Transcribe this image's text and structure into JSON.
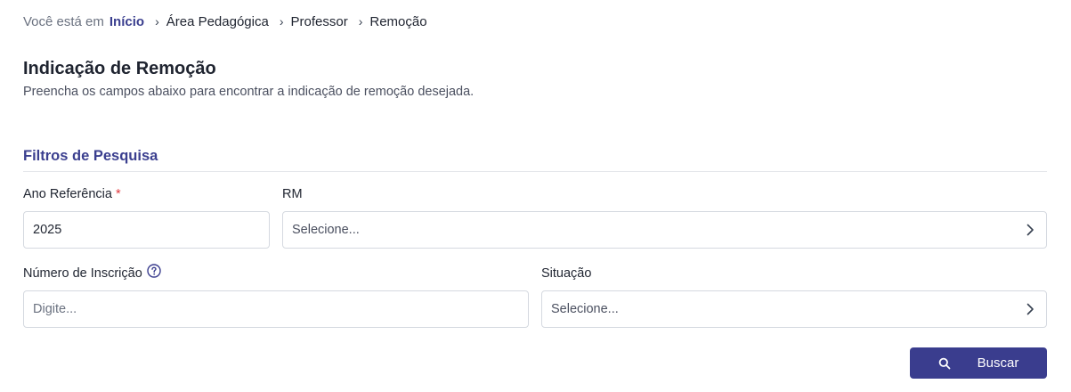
{
  "breadcrumb": {
    "prefix": "Você está em",
    "home": "Início",
    "items": [
      "Área Pedagógica",
      "Professor",
      "Remoção"
    ]
  },
  "page": {
    "title": "Indicação de Remoção",
    "subtitle": "Preencha os campos abaixo para encontrar a indicação de remoção desejada."
  },
  "filters": {
    "section_title": "Filtros de Pesquisa",
    "ano_referencia": {
      "label": "Ano Referência",
      "required_mark": "*",
      "value": "2025"
    },
    "rm": {
      "label": "RM",
      "placeholder": "Selecione..."
    },
    "numero_inscricao": {
      "label": "Número de Inscrição",
      "placeholder": "Digite...",
      "help_icon": "question-circle-icon"
    },
    "situacao": {
      "label": "Situação",
      "placeholder": "Selecione..."
    }
  },
  "actions": {
    "search_label": "Buscar",
    "search_icon": "search-icon"
  },
  "colors": {
    "accent": "#3a3d8e",
    "required": "#e0393e",
    "border": "#d5d9e0"
  }
}
